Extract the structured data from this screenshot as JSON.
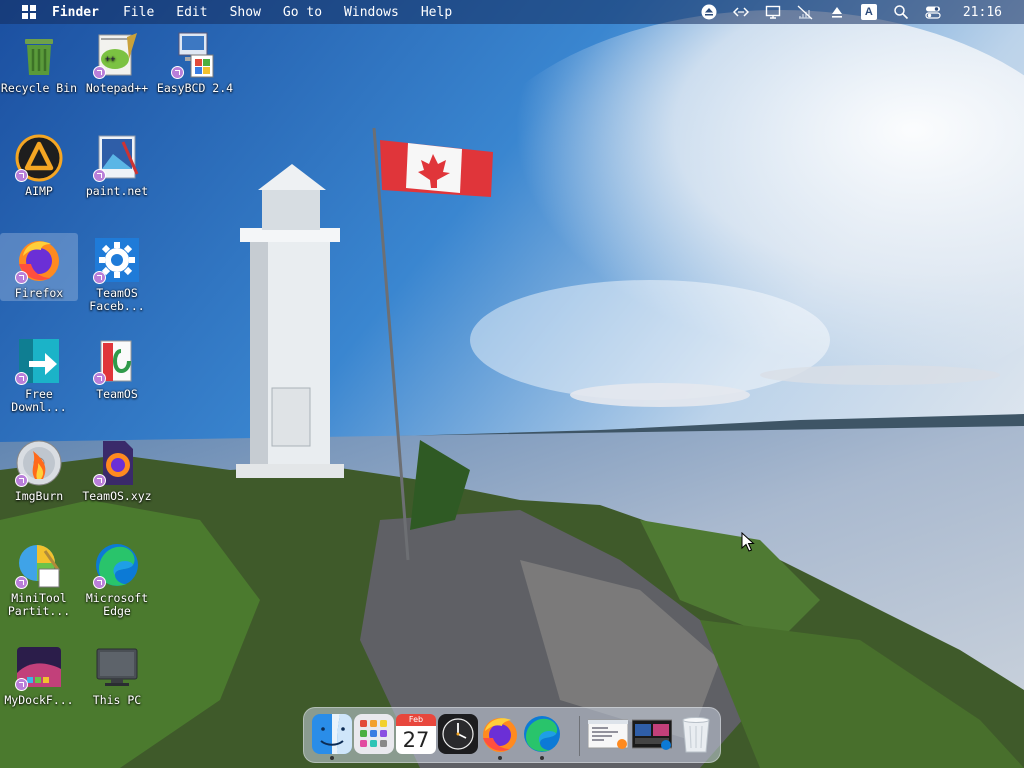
{
  "menubar": {
    "app_name": "Finder",
    "menus": [
      "File",
      "Edit",
      "Show",
      "Go to",
      "Windows",
      "Help"
    ],
    "tray_icons": [
      "eject-icon",
      "code-icon",
      "display-icon",
      "network-icon",
      "upload-icon",
      "input-method-icon",
      "search-icon",
      "control-center-icon"
    ],
    "input_method_label": "A",
    "clock": "21:16"
  },
  "desktop": {
    "icons": [
      {
        "label": "Recycle Bin",
        "icon": "recycle-bin-icon"
      },
      {
        "label": "Notepad++",
        "icon": "notepad-plus-plus-icon"
      },
      {
        "label": "EasyBCD 2.4",
        "icon": "easybcd-icon"
      },
      {
        "label": "AIMP",
        "icon": "aimp-icon"
      },
      {
        "label": "paint.net",
        "icon": "paint-net-icon"
      },
      {
        "label": "Firefox",
        "icon": "firefox-icon"
      },
      {
        "label": "TeamOS Faceb...",
        "icon": "gear-icon"
      },
      {
        "label": "Free Downl...",
        "icon": "free-download-icon"
      },
      {
        "label": "TeamOS",
        "icon": "teamos-icon"
      },
      {
        "label": "ImgBurn",
        "icon": "imgburn-icon"
      },
      {
        "label": "TeamOS.xyz",
        "icon": "firefox-document-icon"
      },
      {
        "label": "MiniTool Partit...",
        "icon": "minitool-icon"
      },
      {
        "label": "Microsoft Edge",
        "icon": "edge-icon"
      },
      {
        "label": "MyDockF...",
        "icon": "mydock-icon"
      },
      {
        "label": "This PC",
        "icon": "monitor-icon"
      }
    ],
    "selected": "Firefox"
  },
  "dock": {
    "items": [
      "finder-icon",
      "launchpad-icon",
      "calendar-icon",
      "clock-icon",
      "firefox-icon",
      "edge-icon",
      "window-thumbnail-icon",
      "window-thumbnail-icon",
      "trash-icon"
    ],
    "calendar_month": "Feb",
    "calendar_day": "27"
  }
}
